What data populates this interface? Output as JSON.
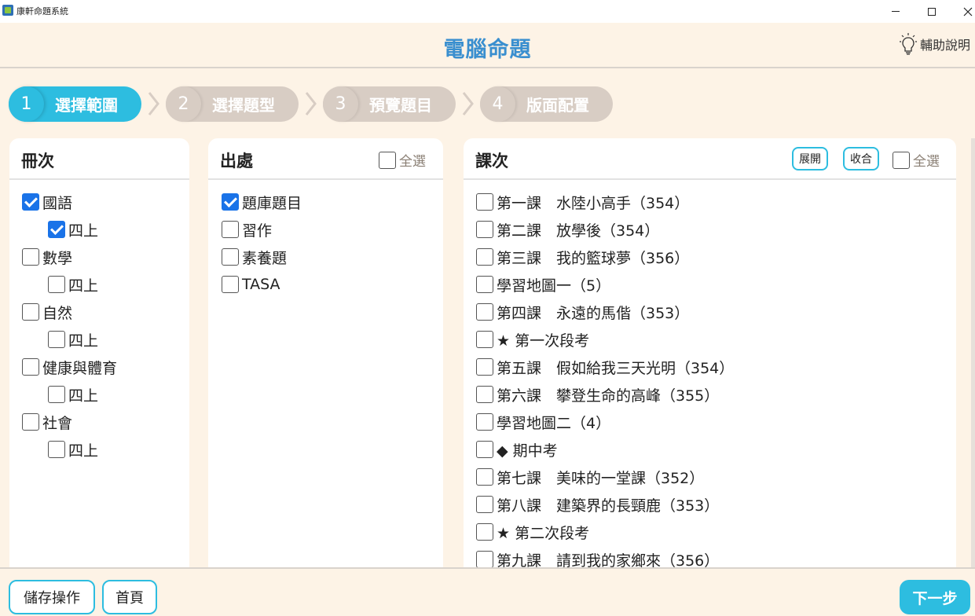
{
  "window": {
    "title": "康軒命題系統"
  },
  "header": {
    "title": "電腦命題",
    "help_label": "輔助說明"
  },
  "steps": [
    {
      "num": "1",
      "label": "選擇範圍",
      "active": true
    },
    {
      "num": "2",
      "label": "選擇題型",
      "active": false
    },
    {
      "num": "3",
      "label": "預覽題目",
      "active": false
    },
    {
      "num": "4",
      "label": "版面配置",
      "active": false
    }
  ],
  "volumes": {
    "title": "冊次",
    "items": [
      {
        "label": "國語",
        "checked": true,
        "level": 0
      },
      {
        "label": "四上",
        "checked": true,
        "level": 1
      },
      {
        "label": "數學",
        "checked": false,
        "level": 0
      },
      {
        "label": "四上",
        "checked": false,
        "level": 1
      },
      {
        "label": "自然",
        "checked": false,
        "level": 0
      },
      {
        "label": "四上",
        "checked": false,
        "level": 1
      },
      {
        "label": "健康與體育",
        "checked": false,
        "level": 0
      },
      {
        "label": "四上",
        "checked": false,
        "level": 1
      },
      {
        "label": "社會",
        "checked": false,
        "level": 0
      },
      {
        "label": "四上",
        "checked": false,
        "level": 1
      }
    ]
  },
  "sources": {
    "title": "出處",
    "select_all_label": "全選",
    "items": [
      {
        "label": "題庫題目",
        "checked": true
      },
      {
        "label": "習作",
        "checked": false
      },
      {
        "label": "素養題",
        "checked": false
      },
      {
        "label": "TASA",
        "checked": false
      }
    ]
  },
  "lessons": {
    "title": "課次",
    "expand_label": "展開",
    "collapse_label": "收合",
    "select_all_label": "全選",
    "items": [
      {
        "label": "第一課　水陸小高手（354）",
        "checked": false
      },
      {
        "label": "第二課　放學後（354）",
        "checked": false
      },
      {
        "label": "第三課　我的籃球夢（356）",
        "checked": false
      },
      {
        "label": "學習地圖一（5）",
        "checked": false
      },
      {
        "label": "第四課　永遠的馬偕（353）",
        "checked": false
      },
      {
        "label": "★ 第一次段考",
        "checked": false
      },
      {
        "label": "第五課　假如給我三天光明（354）",
        "checked": false
      },
      {
        "label": "第六課　攀登生命的高峰（355）",
        "checked": false
      },
      {
        "label": "學習地圖二（4）",
        "checked": false
      },
      {
        "label": "◆ 期中考",
        "checked": false
      },
      {
        "label": "第七課　美味的一堂課（352）",
        "checked": false
      },
      {
        "label": "第八課　建築界的長頸鹿（353）",
        "checked": false
      },
      {
        "label": "★ 第二次段考",
        "checked": false
      },
      {
        "label": "第九課　請到我的家鄉來（356）",
        "checked": false
      }
    ]
  },
  "footer": {
    "save_label": "儲存操作",
    "home_label": "首頁",
    "next_label": "下一步"
  }
}
